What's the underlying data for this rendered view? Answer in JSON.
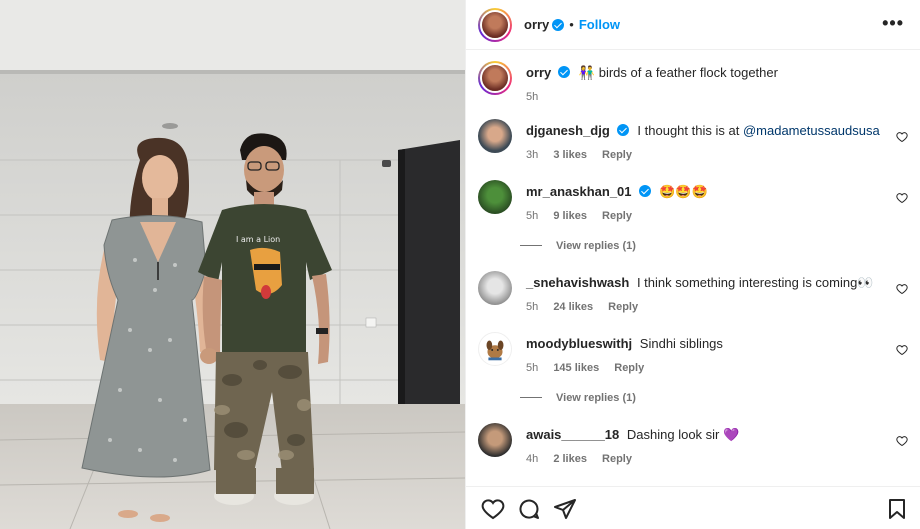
{
  "post": {
    "author": "orry",
    "follow_label": "Follow",
    "more_label": "•••",
    "separator": "•",
    "caption_emoji": "👫",
    "caption": "birds of a feather flock together",
    "caption_time": "5h",
    "photo_shirt_text": "I am a Lion"
  },
  "comments": [
    {
      "user": "djganesh_djg",
      "verified": true,
      "text": "I thought this is at",
      "mention": "@madametussaudsusa",
      "time": "3h",
      "likes": "3 likes",
      "reply": "Reply"
    },
    {
      "user": "mr_anaskhan_01",
      "verified": true,
      "text": "🤩🤩🤩",
      "time": "5h",
      "likes": "9 likes",
      "reply": "Reply",
      "view_replies": "View replies (1)"
    },
    {
      "user": "_snehavishwash",
      "verified": false,
      "text": "I think something interesting is coming👀",
      "time": "5h",
      "likes": "24 likes",
      "reply": "Reply"
    },
    {
      "user": "moodyblueswithj",
      "verified": false,
      "text": "Sindhi siblings",
      "time": "5h",
      "likes": "145 likes",
      "reply": "Reply",
      "view_replies": "View replies (1)"
    },
    {
      "user": "awais______18",
      "verified": false,
      "text": "Dashing look sir 💜",
      "time": "4h",
      "likes": "2 likes",
      "reply": "Reply"
    }
  ],
  "colors": {
    "accent": "#0095f6",
    "text": "#262626",
    "muted": "#737373"
  },
  "icons": [
    "heart-icon",
    "comment-icon",
    "share-icon",
    "bookmark-icon",
    "verified-badge-icon",
    "more-options-icon"
  ]
}
